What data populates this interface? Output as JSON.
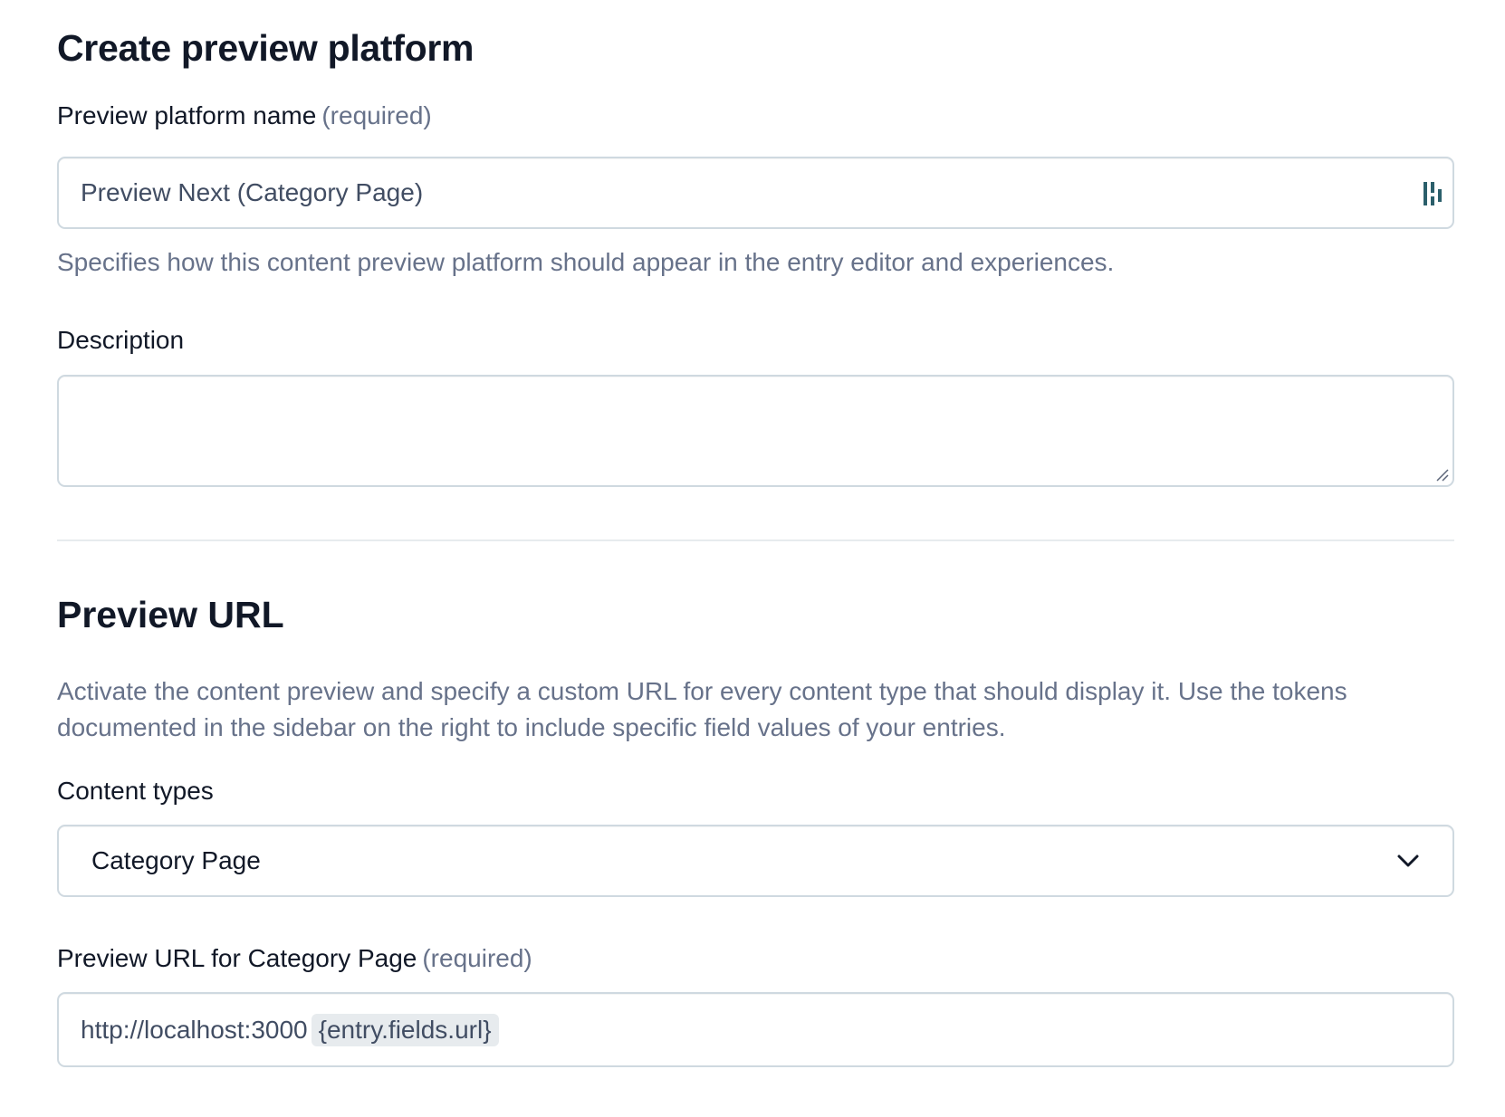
{
  "form": {
    "title": "Create preview platform",
    "name_field": {
      "label": "Preview platform name",
      "required": "(required)",
      "value": "Preview Next (Category Page)",
      "help": "Specifies how this content preview platform should appear in the entry editor and experiences."
    },
    "description_field": {
      "label": "Description",
      "value": ""
    }
  },
  "preview_url": {
    "title": "Preview URL",
    "help": "Activate the content preview and specify a custom URL for every content type that should display it. Use the tokens documented in the sidebar on the right to include specific field values of your entries.",
    "content_types": {
      "label": "Content types",
      "selected": "Category Page"
    },
    "url_field": {
      "label": "Preview URL for Category Page",
      "required": "(required)",
      "base": "http://localhost:3000",
      "token": "{entry.fields.url}"
    }
  },
  "colors": {
    "text_dark": "#111827",
    "text_muted": "#67728a",
    "border": "#cfd9e0",
    "token_bg": "#e7ebee",
    "icon_teal": "#2b5f6b"
  },
  "icons": {
    "name_field_extension": "extension-icon",
    "dropdown": "chevron-down-icon",
    "resize": "resize-handle-icon"
  }
}
